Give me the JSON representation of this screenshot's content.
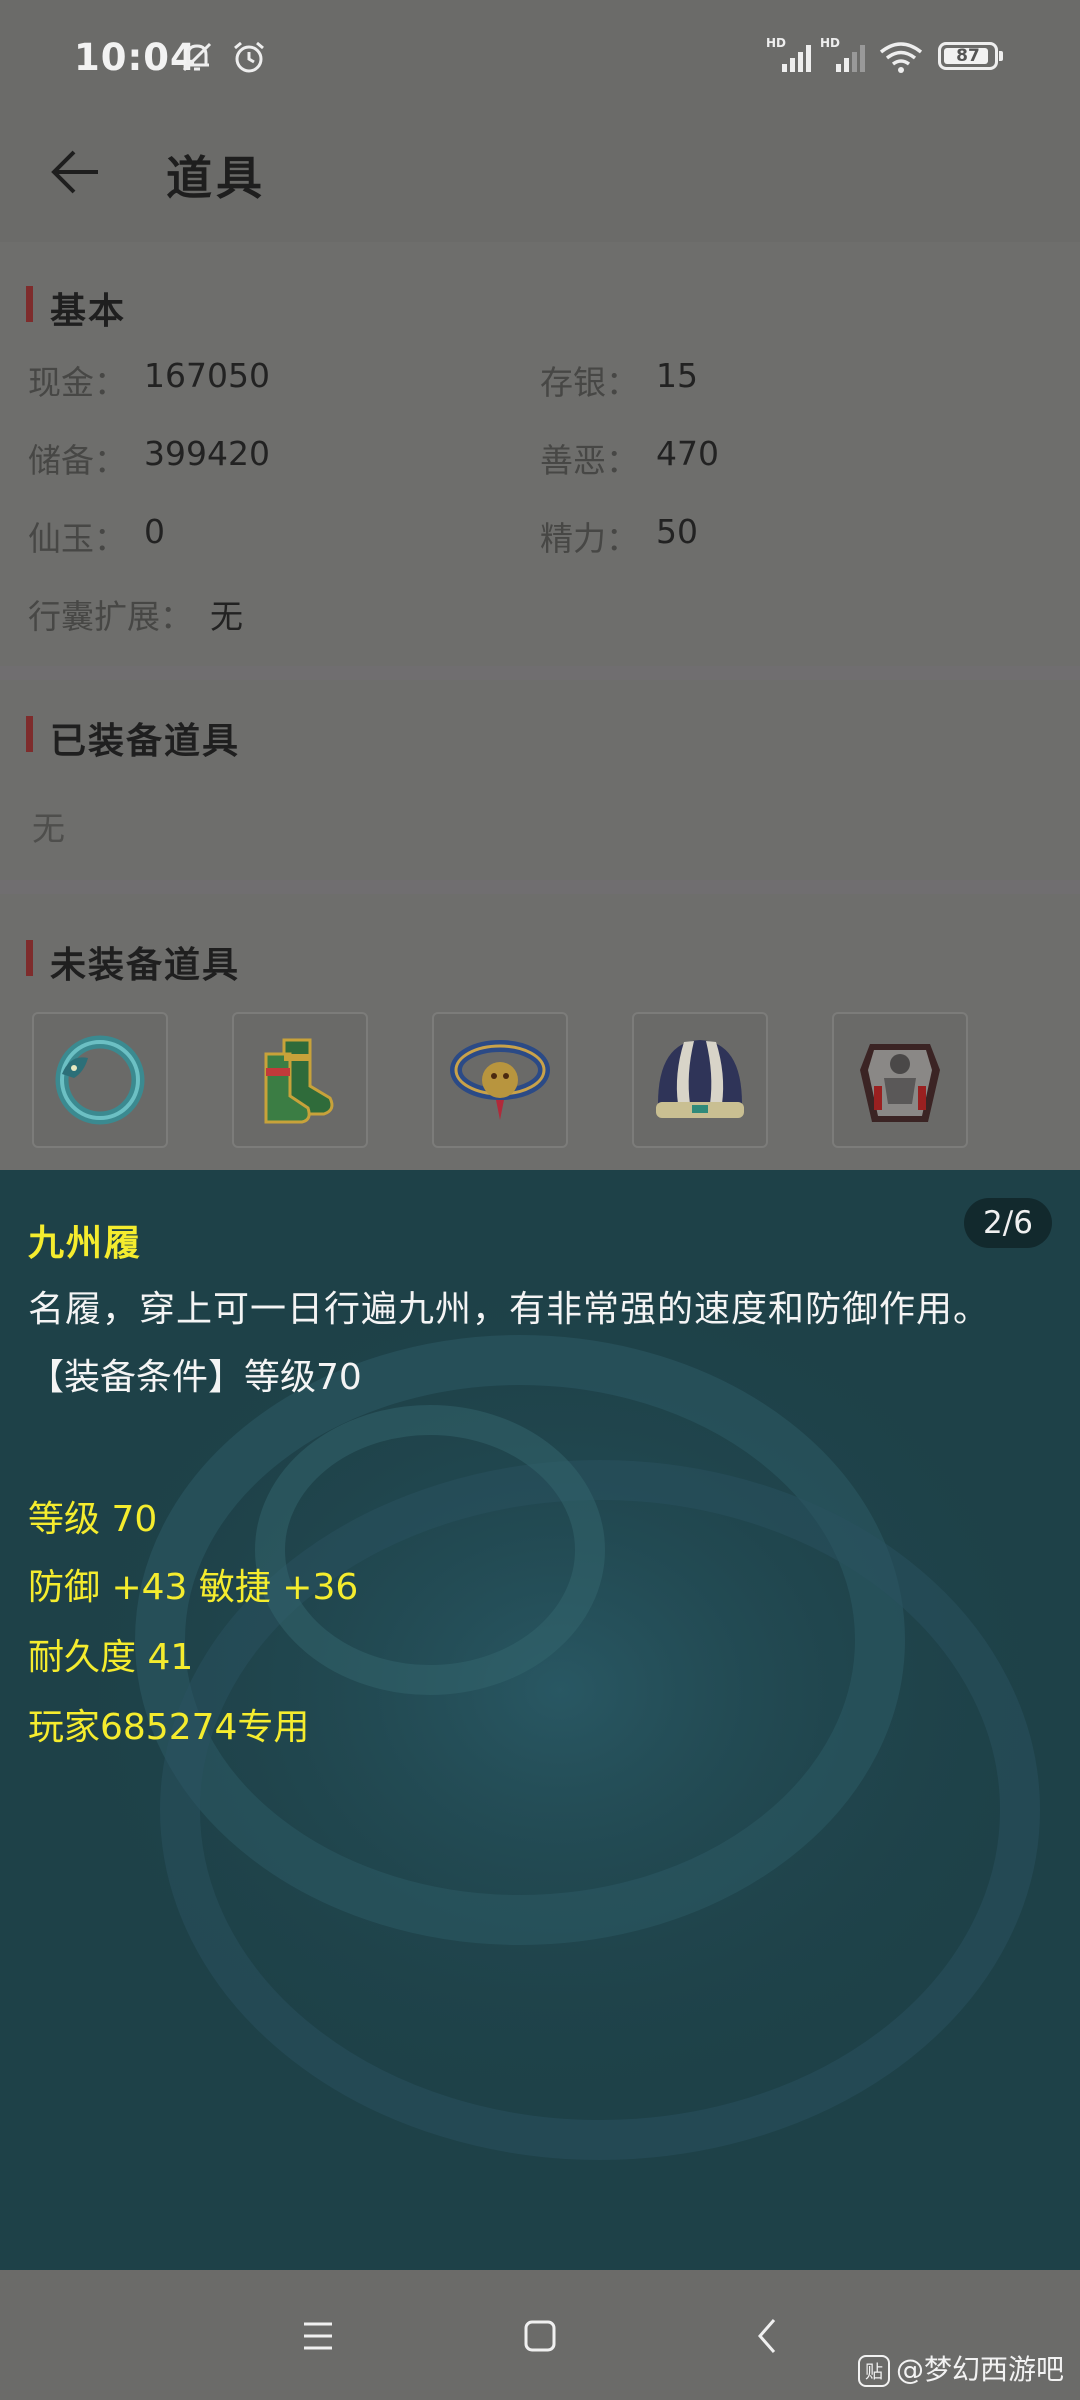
{
  "status_bar": {
    "time": "10:04",
    "hd_label": "HD",
    "battery_level": "87"
  },
  "header": {
    "title": "道具"
  },
  "basic": {
    "title": "基本",
    "fields": [
      {
        "label": "现金：",
        "value": "167050"
      },
      {
        "label": "存银：",
        "value": "15"
      },
      {
        "label": "储备：",
        "value": "399420"
      },
      {
        "label": "善恶：",
        "value": "470"
      },
      {
        "label": "仙玉：",
        "value": "0"
      },
      {
        "label": "精力：",
        "value": "50"
      },
      {
        "label": "行囊扩展：",
        "value": "无"
      }
    ]
  },
  "equipped": {
    "title": "已装备道具",
    "empty_text": "无"
  },
  "unequipped": {
    "title": "未装备道具",
    "items": [
      {
        "icon": "dragon-bracelet-icon"
      },
      {
        "icon": "boots-icon"
      },
      {
        "icon": "demon-belt-icon"
      },
      {
        "icon": "helmet-icon"
      },
      {
        "icon": "armor-icon"
      }
    ]
  },
  "tooltip": {
    "page_indicator": "2/6",
    "name": "九州履",
    "description": "名履，穿上可一日行遍九州，有非常强的速度和防御作用。",
    "requirement": "【装备条件】等级70",
    "stats": [
      "等级 70",
      "防御 +43 敏捷 +36",
      "耐久度 41",
      "玩家685274专用"
    ],
    "colors": {
      "name": "#f5ec2e",
      "stats": "#f5ec2e",
      "text": "#f4f4f4",
      "background": "#1e4148"
    }
  },
  "watermark": {
    "logo": "贴",
    "text": "@梦幻西游吧"
  }
}
